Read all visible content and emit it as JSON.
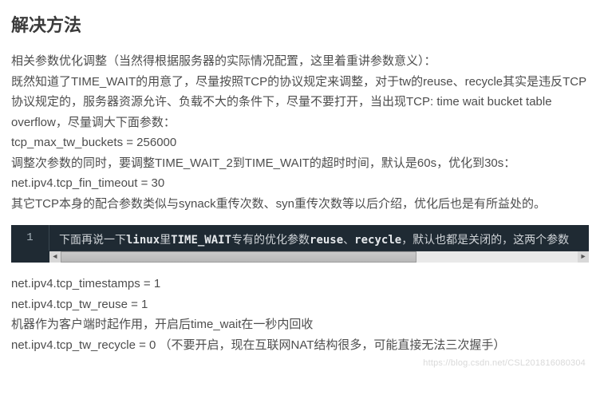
{
  "heading": "解决方法",
  "paragraphs_top": [
    "相关参数优化调整（当然得根据服务器的实际情况配置，这里着重讲参数意义）：",
    "既然知道了TIME_WAIT的用意了，尽量按照TCP的协议规定来调整，对于tw的reuse、recycle其实是违反TCP协议规定的，服务器资源允许、负载不大的条件下，尽量不要打开，当出现TCP: time wait bucket table overflow，尽量调大下面参数：",
    "tcp_max_tw_buckets = 256000",
    "调整次参数的同时，要调整TIME_WAIT_2到TIME_WAIT的超时时间，默认是60s，优化到30s：",
    "net.ipv4.tcp_fin_timeout = 30",
    "其它TCP本身的配合参数类似与synack重传次数、syn重传次数等以后介绍，优化后也是有所益处的。"
  ],
  "code": {
    "line_number": "1",
    "segments": [
      {
        "text": "下面再说一下",
        "hl": false
      },
      {
        "text": "linux",
        "hl": true
      },
      {
        "text": "里",
        "hl": false
      },
      {
        "text": "TIME_WAIT",
        "hl": true
      },
      {
        "text": "专有的优化参数",
        "hl": false
      },
      {
        "text": "reuse",
        "hl": true
      },
      {
        "text": "、",
        "hl": false
      },
      {
        "text": "recycle",
        "hl": true
      },
      {
        "text": "，默认也都是关闭的，这两个参数",
        "hl": false
      }
    ]
  },
  "paragraphs_bottom": [
    "net.ipv4.tcp_timestamps = 1",
    "net.ipv4.tcp_tw_reuse = 1",
    "机器作为客户端时起作用，开启后time_wait在一秒内回收",
    "net.ipv4.tcp_tw_recycle = 0 （不要开启，现在互联网NAT结构很多，可能直接无法三次握手）"
  ],
  "watermark": "https://blog.csdn.net/CSL201816080304",
  "scroll_arrow_left": "◄",
  "scroll_arrow_right": "►"
}
